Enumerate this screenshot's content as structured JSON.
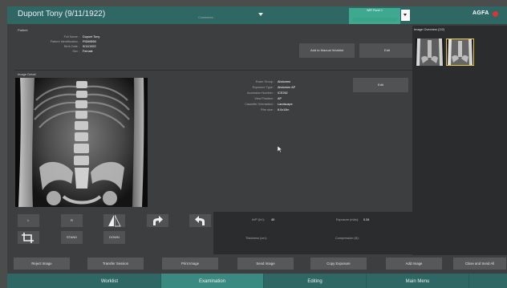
{
  "header": {
    "patient_title": "Dupont Tony (9/11/1922)",
    "panel_select": "WiFi Panel 1",
    "logo_text": "AGFA"
  },
  "patient": {
    "section_title": "Patient",
    "fields": [
      {
        "label": "Full Name :",
        "value": "Dupont Tony"
      },
      {
        "label": "Patient Identification :",
        "value": "PID89550"
      },
      {
        "label": "Birth Date :",
        "value": "9/11/1922"
      },
      {
        "label": "Sex :",
        "value": "Female"
      }
    ],
    "comments_label": "Comments :",
    "add_to_worklist": "Add to Manual Worklist",
    "edit": "Edit"
  },
  "image_detail": {
    "section_title": "Image Detail",
    "fields": [
      {
        "label": "Exam Group :",
        "value": "Abdomen"
      },
      {
        "label": "Exposure Type :",
        "value": "Abdomen AP"
      },
      {
        "label": "Accession Number :",
        "value": "ICE262"
      },
      {
        "label": "View Position :",
        "value": "AP"
      },
      {
        "label": "Cassette Orientation :",
        "value": "Landscape"
      },
      {
        "label": "Film size :",
        "value": "8.0x10in"
      }
    ],
    "edit": "Edit"
  },
  "overview": {
    "title": "Image Overview (2/2)"
  },
  "tools": {
    "left": "L",
    "right": "R",
    "stand": "STAND",
    "down": "DOWN"
  },
  "parameters": {
    "kvp_label": "kVP (kV):",
    "kvp_value": "40",
    "exposure_label": "Exposure (mAs):",
    "exposure_value": "0.34",
    "thickness_label": "Thickness (cm):",
    "compression_label": "Compression (N):"
  },
  "actions": [
    "Reject Image",
    "Transfer Session",
    "Print Image",
    "Send Image",
    "Copy Exposure",
    "Add Image",
    "Close and Send All"
  ],
  "nav": {
    "tabs": [
      "Worklist",
      "Examination",
      "Editing",
      "Main Menu"
    ],
    "active": "Examination"
  },
  "colors": {
    "brand_teal": "#2e6763",
    "active_tab": "#3a8a81",
    "selected_thumb": "#e7c84c",
    "panel_select": "#3fa98f"
  }
}
